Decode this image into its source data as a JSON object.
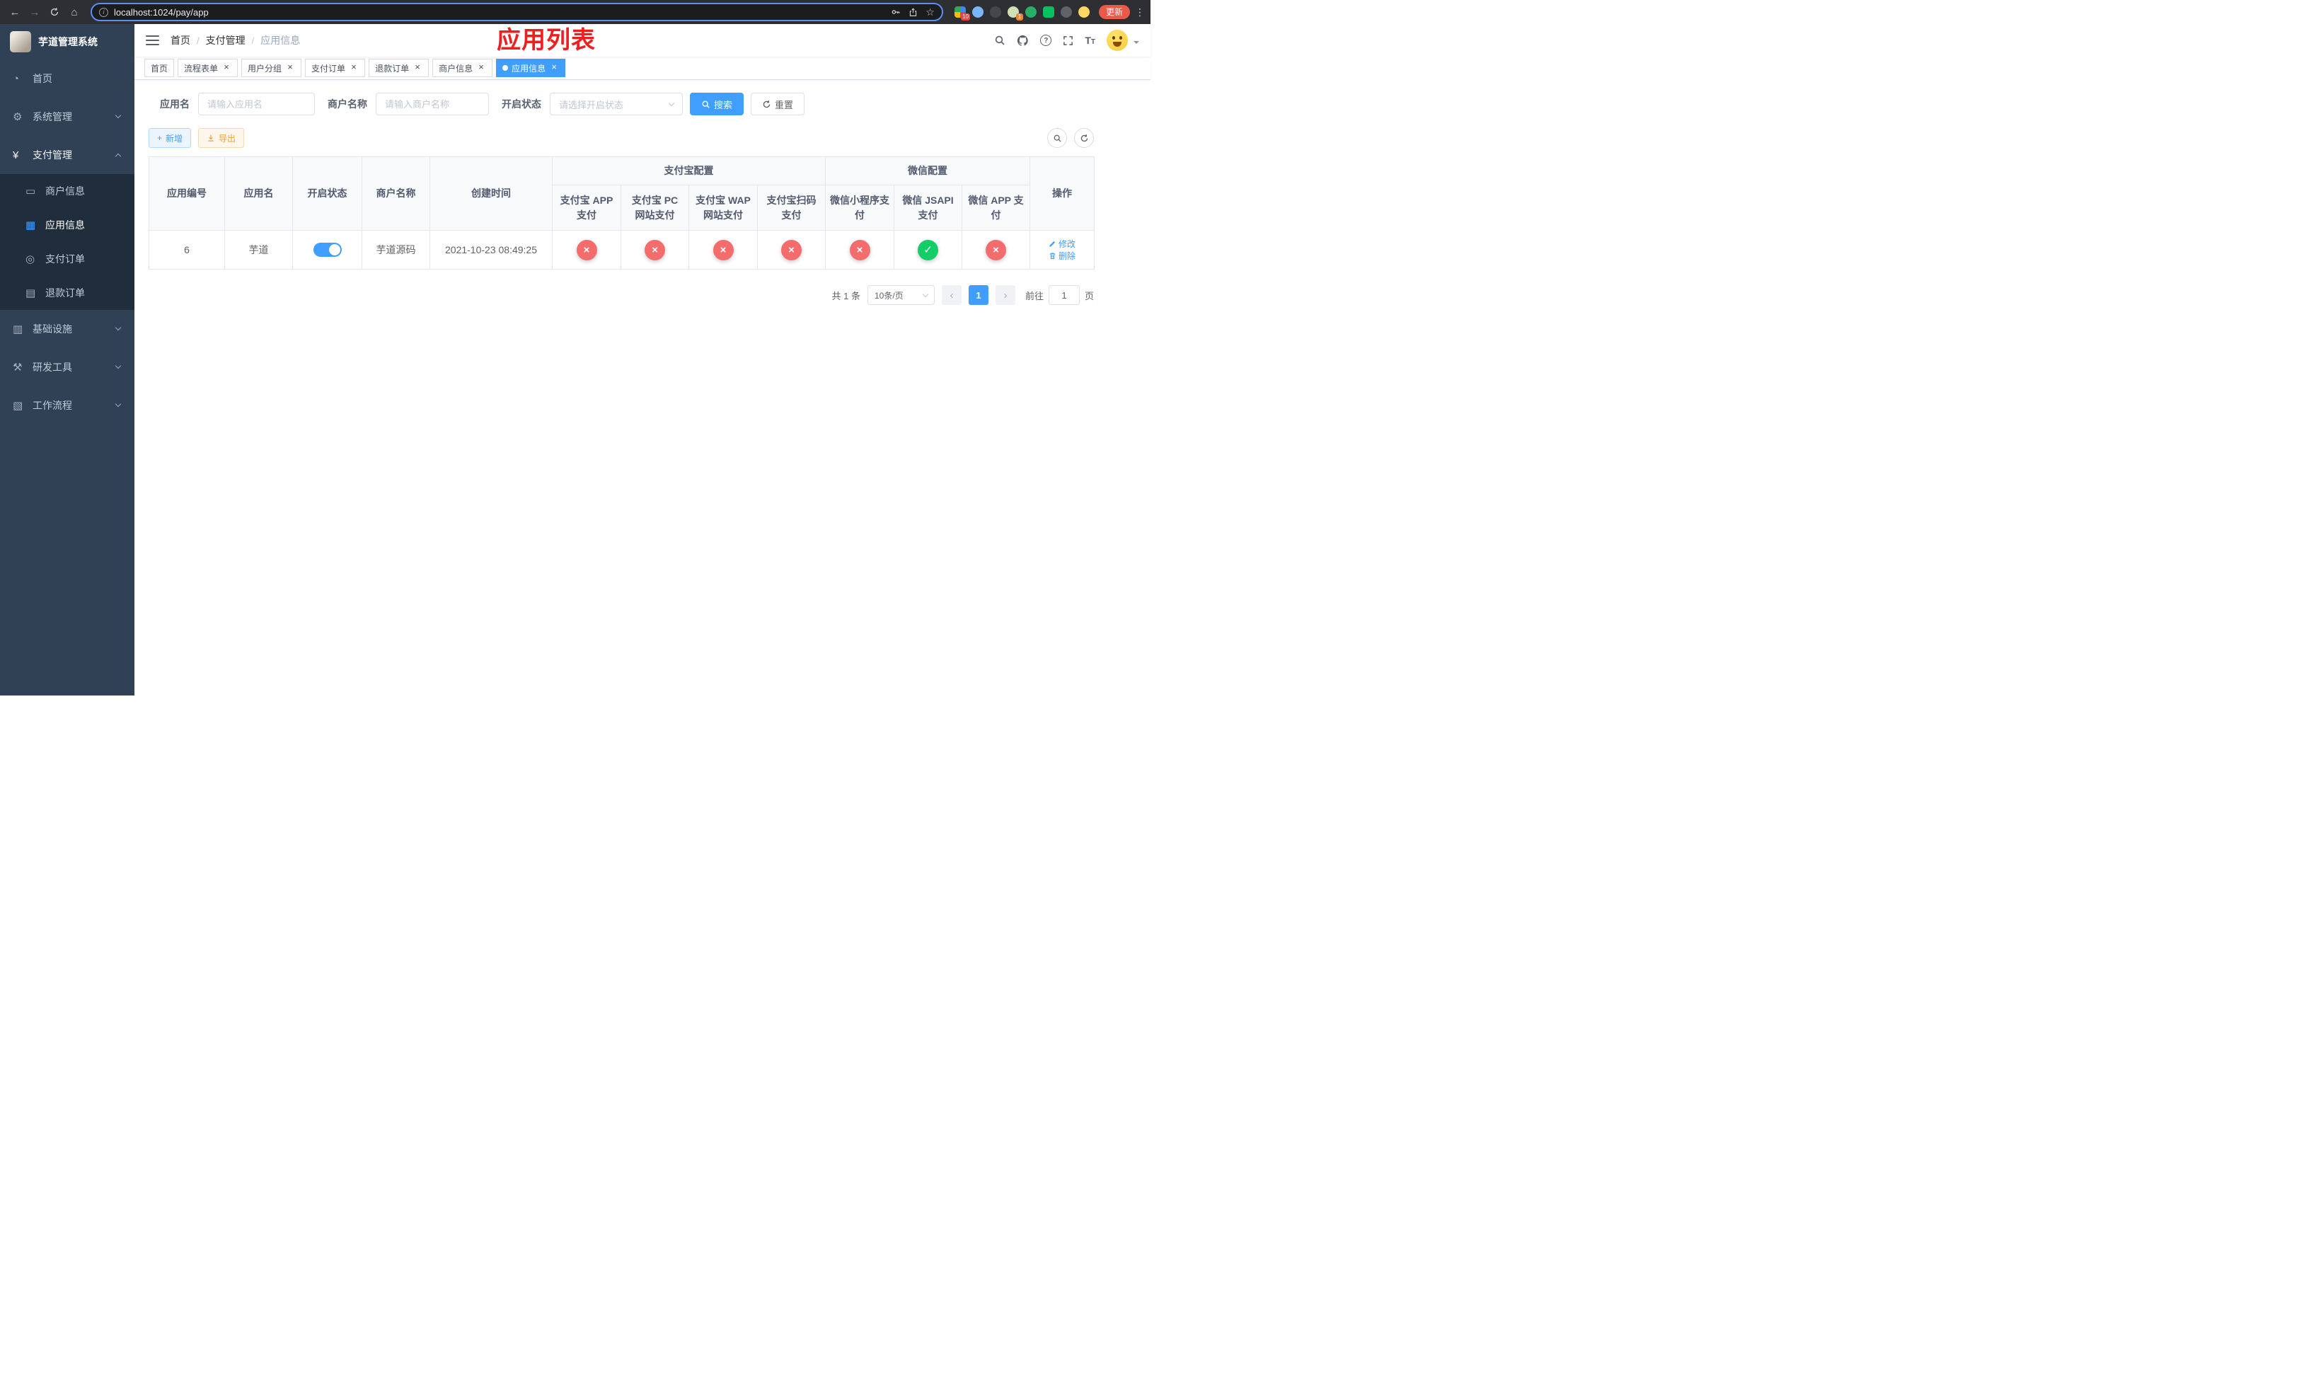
{
  "colors": {
    "primary": "#409eff",
    "danger": "#f56c6c",
    "success": "#13ce66",
    "warning": "#e6a23c",
    "title-red": "#f01f1f",
    "update-red": "#ea5a47"
  },
  "browser": {
    "url": "localhost:1024/pay/app",
    "update_label": "更新",
    "extension_badges": {
      "first": "10",
      "second": "1"
    }
  },
  "sidebar": {
    "title": "芋道管理系统",
    "menu": [
      {
        "key": "home",
        "icon": "dashboard-icon",
        "glyph": "◔",
        "label": "首页"
      },
      {
        "key": "system",
        "icon": "gear-icon",
        "glyph": "⚙",
        "label": "系统管理",
        "chevron": "down"
      },
      {
        "key": "payment",
        "icon": "yen-icon",
        "glyph": "¥",
        "label": "支付管理",
        "chevron": "up",
        "expanded": true,
        "children": [
          {
            "key": "merchant-info",
            "icon": "bank-card-icon",
            "glyph": "▭",
            "label": "商户信息"
          },
          {
            "key": "app-info",
            "icon": "grid-icon",
            "glyph": "▦",
            "label": "应用信息",
            "active": true
          },
          {
            "key": "payment-order",
            "icon": "target-icon",
            "glyph": "◎",
            "label": "支付订单"
          },
          {
            "key": "refund-order",
            "icon": "document-icon",
            "glyph": "▤",
            "label": "退款订单"
          }
        ]
      },
      {
        "key": "infrastructure",
        "icon": "server-icon",
        "glyph": "▥",
        "label": "基础设施",
        "chevron": "down"
      },
      {
        "key": "dev-tools",
        "icon": "hammer-icon",
        "glyph": "⚒",
        "label": "研发工具",
        "chevron": "down"
      },
      {
        "key": "workflow",
        "icon": "flow-icon",
        "glyph": "▧",
        "label": "工作流程",
        "chevron": "down"
      }
    ]
  },
  "header": {
    "breadcrumb": [
      "首页",
      "支付管理",
      "应用信息"
    ],
    "overlay_title": "应用列表"
  },
  "tabs": [
    {
      "label": "首页",
      "closable": false
    },
    {
      "label": "流程表单",
      "closable": true
    },
    {
      "label": "用户分组",
      "closable": true
    },
    {
      "label": "支付订单",
      "closable": true
    },
    {
      "label": "退款订单",
      "closable": true
    },
    {
      "label": "商户信息",
      "closable": true
    },
    {
      "label": "应用信息",
      "closable": true,
      "active": true
    }
  ],
  "filters": {
    "app_name_label": "应用名",
    "app_name_placeholder": "请输入应用名",
    "merchant_label": "商户名称",
    "merchant_placeholder": "请输入商户名称",
    "status_label": "开启状态",
    "status_placeholder": "请选择开启状态",
    "search_label": "搜索",
    "reset_label": "重置"
  },
  "toolbar": {
    "add_label": "新增",
    "export_label": "导出"
  },
  "table": {
    "columns": [
      "应用编号",
      "应用名",
      "开启状态",
      "商户名称",
      "创建时间"
    ],
    "groups": [
      {
        "label": "支付宝配置",
        "columns": [
          "支付宝 APP 支付",
          "支付宝 PC 网站支付",
          "支付宝 WAP 网站支付",
          "支付宝扫码支付"
        ]
      },
      {
        "label": "微信配置",
        "columns": [
          "微信小程序支付",
          "微信 JSAPI 支付",
          "微信 APP 支付"
        ]
      }
    ],
    "ops_label": "操作",
    "rows": [
      {
        "id": "6",
        "name": "芋道",
        "enabled": true,
        "merchant": "芋道源码",
        "created": "2021-10-23 08:49:25",
        "statuses": [
          false,
          false,
          false,
          false,
          false,
          true,
          false
        ],
        "edit_label": "修改",
        "delete_label": "删除"
      }
    ]
  },
  "pagination": {
    "total": "共 1 条",
    "page_size": "10条/页",
    "current_page": "1",
    "goto_label": "前往",
    "goto_value": "1",
    "goto_suffix": "页"
  }
}
